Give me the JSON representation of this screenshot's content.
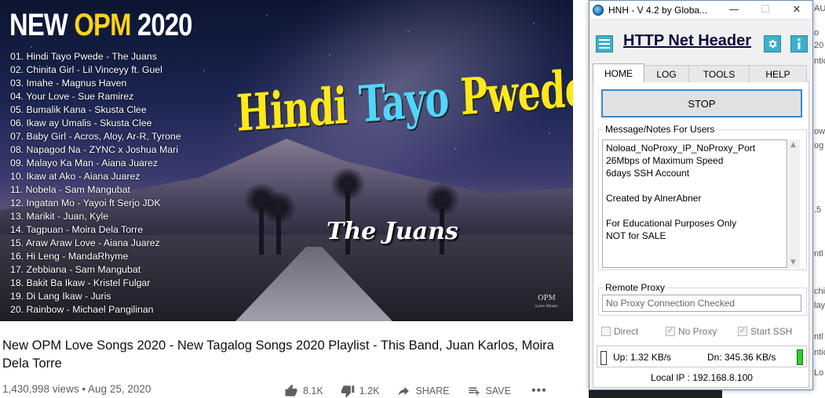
{
  "video": {
    "thumbnail_title_prefix": "NEW ",
    "thumbnail_title_accent": "OPM",
    "thumbnail_title_suffix": " 2020",
    "tracklist": [
      "01. Hindi Tayo Pwede - The Juans",
      "02. Chinita Girl - Lil Vinceyy ft. Guel",
      "03. Imahe - Magnus Haven",
      "04. Your Love - Sue Ramirez",
      "05. Bumalik Kana - Skusta Clee",
      "06. Ikaw ay Umalis - Skusta Clee",
      "07. Baby Girl - Acros, Aloy, Ar-R, Tyrone",
      "08. Napagod Na - ZYNC x Joshua Mari",
      "09. Malayo Ka Man - Aiana Juarez",
      "10. Ikaw at Ako - Aiana Juarez",
      "11. Nobela - Sam Mangubat",
      "12. Ingatan Mo - Yayoi ft Serjo JDK",
      "13. Marikit - Juan, Kyle",
      "14. Tagpuan - Moira Dela Torre",
      "15. Araw Araw Love - Aiana Juarez",
      "16. Hi Leng - MandaRhyme",
      "17. Zebbiana - Sam Mangubat",
      "18. Bakit Ba Ikaw - Kristel Fulgar",
      "19. Di Lang Ikaw - Juris",
      "20. Rainbow - Michael Pangilinan"
    ],
    "song_word1": "Hindi ",
    "song_word2": "Tayo ",
    "song_word3": "Pwede",
    "artist": "The Juans",
    "logo_text": "OPM",
    "logo_sub": "Love Music",
    "title": "New OPM Love Songs 2020 - New Tagalog Songs 2020 Playlist - This Band, Juan Karlos, Moira Dela Torre",
    "meta": "1,430,998 views • Aug 25, 2020",
    "likes": "8.1K",
    "dislikes": "1.2K",
    "share_label": "SHARE",
    "save_label": "SAVE",
    "more_label": "•••"
  },
  "window": {
    "title": "HNH - V 4.2 by Globa...",
    "minimize": "—",
    "maximize": "☐",
    "close": "✕",
    "app_name": "HTTP Net Header",
    "tabs": [
      {
        "label": "HOME",
        "active": true
      },
      {
        "label": "LOG",
        "active": false
      },
      {
        "label": "TOOLS",
        "active": false
      },
      {
        "label": "HELP",
        "active": false
      }
    ],
    "stop_label": "STOP",
    "notes_legend": "Message/Notes For Users",
    "notes_lines": [
      "Noload_NoProxy_IP_NoProxy_Port",
      "26Mbps of Maximum Speed",
      "6days SSH Account",
      "",
      "Created by AlnerAbner",
      "",
      "For Educational Purposes Only",
      "NOT for SALE"
    ],
    "proxy_legend": "Remote Proxy",
    "proxy_value": "No Proxy Connection Checked",
    "checks": [
      {
        "label": "Direct",
        "checked": false
      },
      {
        "label": "No Proxy",
        "checked": true
      },
      {
        "label": "Start SSH",
        "checked": true
      }
    ],
    "up_text": "Up: 1.32 KB/s",
    "dn_text": "Dn: 345.36 KB/s",
    "local_ip": "Local IP : 192.168.8.100",
    "led_up_color": "#ffffff",
    "led_dn_color": "#2ed02e"
  },
  "side": {
    "fragments": [
      "AU",
      "o",
      "20",
      "ntic",
      "ow",
      "og",
      ".5",
      "ntl",
      "chi",
      "lay",
      "ntl",
      "ntic",
      "Lo"
    ]
  }
}
